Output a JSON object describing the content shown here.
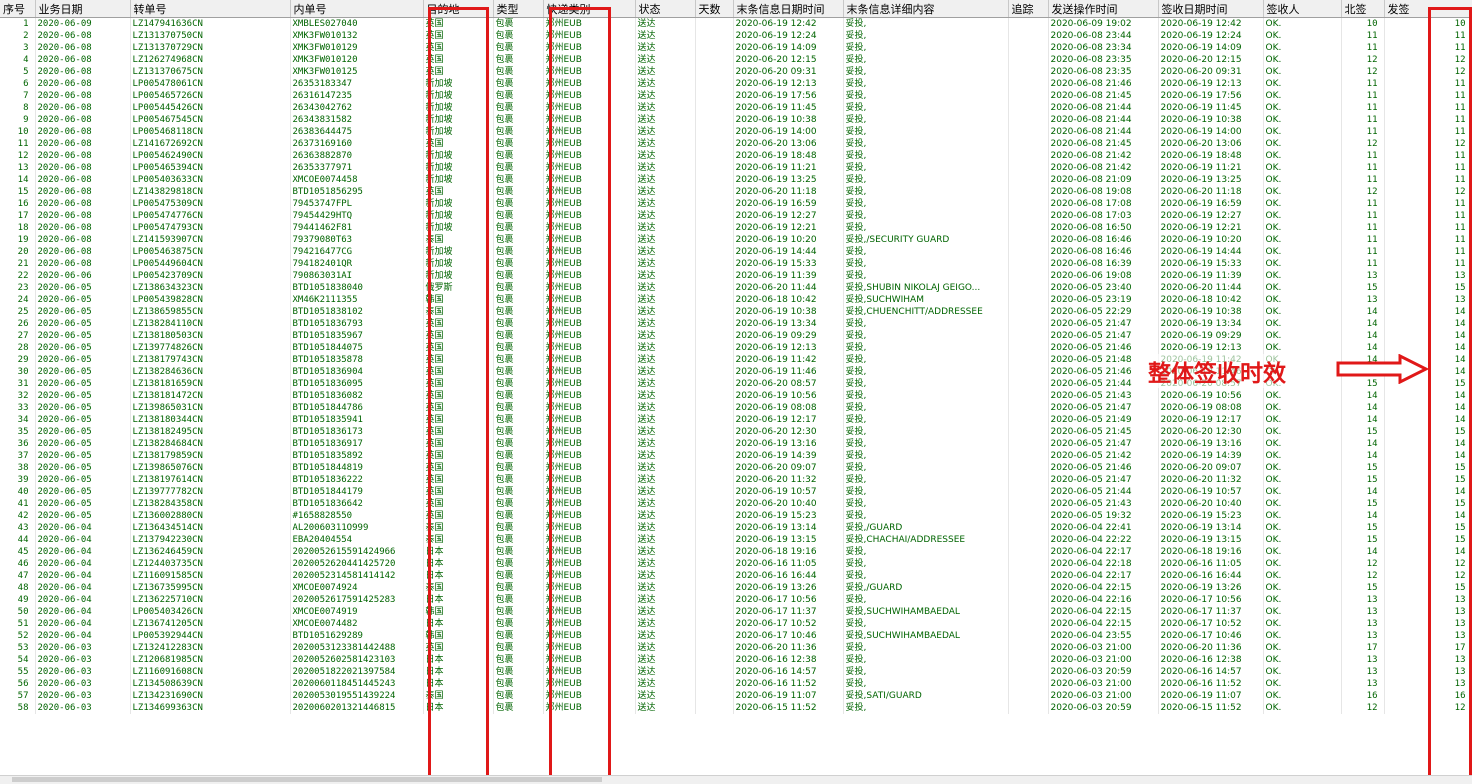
{
  "columns": [
    "序号",
    "业务日期",
    "转单号",
    "内单号",
    "目的地",
    "类型",
    "快递类别",
    "状态",
    "天数",
    "末条信息日期时间",
    "末条信息详细内容",
    "追踪",
    "发送操作时间",
    "签收日期时间",
    "签收人",
    "北签",
    "发签"
  ],
  "annotation": "整体签收时效",
  "rows": [
    [
      "1",
      "2020-06-09",
      "LZ147941636CN",
      "XMBLES027040",
      "英国",
      "包裹",
      "郑州EUB",
      "送达",
      "",
      "2020-06-19 12:42",
      "妥投,",
      "",
      "2020-06-09 19:02",
      "2020-06-19 12:42",
      "OK.",
      "10",
      "10"
    ],
    [
      "2",
      "2020-06-08",
      "LZ131370750CN",
      "XMK3FW010132",
      "英国",
      "包裹",
      "郑州EUB",
      "送达",
      "",
      "2020-06-19 12:24",
      "妥投,",
      "",
      "2020-06-08 23:44",
      "2020-06-19 12:24",
      "OK.",
      "11",
      "11"
    ],
    [
      "3",
      "2020-06-08",
      "LZ131370729CN",
      "XMK3FW010129",
      "英国",
      "包裹",
      "郑州EUB",
      "送达",
      "",
      "2020-06-19 14:09",
      "妥投,",
      "",
      "2020-06-08 23:34",
      "2020-06-19 14:09",
      "OK.",
      "11",
      "11"
    ],
    [
      "4",
      "2020-06-08",
      "LZ126274968CN",
      "XMK3FW010120",
      "英国",
      "包裹",
      "郑州EUB",
      "送达",
      "",
      "2020-06-20 12:15",
      "妥投,",
      "",
      "2020-06-08 23:35",
      "2020-06-20 12:15",
      "OK.",
      "12",
      "12"
    ],
    [
      "5",
      "2020-06-08",
      "LZ131370675CN",
      "XMK3FW010125",
      "英国",
      "包裹",
      "郑州EUB",
      "送达",
      "",
      "2020-06-20 09:31",
      "妥投,",
      "",
      "2020-06-08 23:35",
      "2020-06-20 09:31",
      "OK.",
      "12",
      "12"
    ],
    [
      "6",
      "2020-06-08",
      "LP005478061CN",
      "26353183347",
      "新加坡",
      "包裹",
      "郑州EUB",
      "送达",
      "",
      "2020-06-19 12:13",
      "妥投,",
      "",
      "2020-06-08 21:46",
      "2020-06-19 12:13",
      "OK.",
      "11",
      "11"
    ],
    [
      "7",
      "2020-06-08",
      "LP005465726CN",
      "26316147235",
      "新加坡",
      "包裹",
      "郑州EUB",
      "送达",
      "",
      "2020-06-19 17:56",
      "妥投,",
      "",
      "2020-06-08 21:45",
      "2020-06-19 17:56",
      "OK.",
      "11",
      "11"
    ],
    [
      "8",
      "2020-06-08",
      "LP005445426CN",
      "26343042762",
      "新加坡",
      "包裹",
      "郑州EUB",
      "送达",
      "",
      "2020-06-19 11:45",
      "妥投,",
      "",
      "2020-06-08 21:44",
      "2020-06-19 11:45",
      "OK.",
      "11",
      "11"
    ],
    [
      "9",
      "2020-06-08",
      "LP005467545CN",
      "26343831582",
      "新加坡",
      "包裹",
      "郑州EUB",
      "送达",
      "",
      "2020-06-19 10:38",
      "妥投,",
      "",
      "2020-06-08 21:44",
      "2020-06-19 10:38",
      "OK.",
      "11",
      "11"
    ],
    [
      "10",
      "2020-06-08",
      "LP005468118CN",
      "26383644475",
      "新加坡",
      "包裹",
      "郑州EUB",
      "送达",
      "",
      "2020-06-19 14:00",
      "妥投,",
      "",
      "2020-06-08 21:44",
      "2020-06-19 14:00",
      "OK.",
      "11",
      "11"
    ],
    [
      "11",
      "2020-06-08",
      "LZ141672692CN",
      "26373169160",
      "英国",
      "包裹",
      "郑州EUB",
      "送达",
      "",
      "2020-06-20 13:06",
      "妥投,",
      "",
      "2020-06-08 21:45",
      "2020-06-20 13:06",
      "OK.",
      "12",
      "12"
    ],
    [
      "12",
      "2020-06-08",
      "LP005462490CN",
      "26363882870",
      "新加坡",
      "包裹",
      "郑州EUB",
      "送达",
      "",
      "2020-06-19 18:48",
      "妥投,",
      "",
      "2020-06-08 21:42",
      "2020-06-19 18:48",
      "OK.",
      "11",
      "11"
    ],
    [
      "13",
      "2020-06-08",
      "LP005465394CN",
      "26353377971",
      "新加坡",
      "包裹",
      "郑州EUB",
      "送达",
      "",
      "2020-06-19 11:21",
      "妥投,",
      "",
      "2020-06-08 21:42",
      "2020-06-19 11:21",
      "OK.",
      "11",
      "11"
    ],
    [
      "14",
      "2020-06-08",
      "LP005403633CN",
      "XMCOE0074458",
      "新加坡",
      "包裹",
      "郑州EUB",
      "送达",
      "",
      "2020-06-19 13:25",
      "妥投,",
      "",
      "2020-06-08 21:09",
      "2020-06-19 13:25",
      "OK.",
      "11",
      "11"
    ],
    [
      "15",
      "2020-06-08",
      "LZ143829818CN",
      "BTD1051856295",
      "英国",
      "包裹",
      "郑州EUB",
      "送达",
      "",
      "2020-06-20 11:18",
      "妥投,",
      "",
      "2020-06-08 19:08",
      "2020-06-20 11:18",
      "OK.",
      "12",
      "12"
    ],
    [
      "16",
      "2020-06-08",
      "LP005475309CN",
      "79453747FPL",
      "新加坡",
      "包裹",
      "郑州EUB",
      "送达",
      "",
      "2020-06-19 16:59",
      "妥投,",
      "",
      "2020-06-08 17:08",
      "2020-06-19 16:59",
      "OK.",
      "11",
      "11"
    ],
    [
      "17",
      "2020-06-08",
      "LP005474776CN",
      "79454429HTQ",
      "新加坡",
      "包裹",
      "郑州EUB",
      "送达",
      "",
      "2020-06-19 12:27",
      "妥投,",
      "",
      "2020-06-08 17:03",
      "2020-06-19 12:27",
      "OK.",
      "11",
      "11"
    ],
    [
      "18",
      "2020-06-08",
      "LP005474793CN",
      "79441462F81",
      "新加坡",
      "包裹",
      "郑州EUB",
      "送达",
      "",
      "2020-06-19 12:21",
      "妥投,",
      "",
      "2020-06-08 16:50",
      "2020-06-19 12:21",
      "OK.",
      "11",
      "11"
    ],
    [
      "19",
      "2020-06-08",
      "LZ141593907CN",
      "79379080T63",
      "泰国",
      "包裹",
      "郑州EUB",
      "送达",
      "",
      "2020-06-19 10:20",
      "妥投,/SECURITY GUARD",
      "",
      "2020-06-08 16:46",
      "2020-06-19 10:20",
      "OK.",
      "11",
      "11"
    ],
    [
      "20",
      "2020-06-08",
      "LP005463875CN",
      "794216477CG",
      "新加坡",
      "包裹",
      "郑州EUB",
      "送达",
      "",
      "2020-06-19 14:44",
      "妥投,",
      "",
      "2020-06-08 16:46",
      "2020-06-19 14:44",
      "OK.",
      "11",
      "11"
    ],
    [
      "21",
      "2020-06-08",
      "LP005449604CN",
      "794182401QR",
      "新加坡",
      "包裹",
      "郑州EUB",
      "送达",
      "",
      "2020-06-19 15:33",
      "妥投,",
      "",
      "2020-06-08 16:39",
      "2020-06-19 15:33",
      "OK.",
      "11",
      "11"
    ],
    [
      "22",
      "2020-06-06",
      "LP005423709CN",
      "790863031AI",
      "新加坡",
      "包裹",
      "郑州EUB",
      "送达",
      "",
      "2020-06-19 11:39",
      "妥投,",
      "",
      "2020-06-06 19:08",
      "2020-06-19 11:39",
      "OK.",
      "13",
      "13"
    ],
    [
      "23",
      "2020-06-05",
      "LZ138634323CN",
      "BTD1051838040",
      "俄罗斯",
      "包裹",
      "郑州EUB",
      "送达",
      "",
      "2020-06-20 11:44",
      "妥投,SHUBIN NIKOLAJ GEIGO...",
      "",
      "2020-06-05 23:40",
      "2020-06-20 11:44",
      "OK.",
      "15",
      "15"
    ],
    [
      "24",
      "2020-06-05",
      "LP005439828CN",
      "XM46K2111355",
      "韩国",
      "包裹",
      "郑州EUB",
      "送达",
      "",
      "2020-06-18 10:42",
      "妥投,SUCHWIHAM",
      "",
      "2020-06-05 23:19",
      "2020-06-18 10:42",
      "OK.",
      "13",
      "13"
    ],
    [
      "25",
      "2020-06-05",
      "LZ138659855CN",
      "BTD1051838102",
      "泰国",
      "包裹",
      "郑州EUB",
      "送达",
      "",
      "2020-06-19 10:38",
      "妥投,CHUENCHITT/ADDRESSEE",
      "",
      "2020-06-05 22:29",
      "2020-06-19 10:38",
      "OK.",
      "14",
      "14"
    ],
    [
      "26",
      "2020-06-05",
      "LZ138284110CN",
      "BTD1051836793",
      "英国",
      "包裹",
      "郑州EUB",
      "送达",
      "",
      "2020-06-19 13:34",
      "妥投,",
      "",
      "2020-06-05 21:47",
      "2020-06-19 13:34",
      "OK.",
      "14",
      "14"
    ],
    [
      "27",
      "2020-06-05",
      "LZ138180503CN",
      "BTD1051835967",
      "英国",
      "包裹",
      "郑州EUB",
      "送达",
      "",
      "2020-06-19 09:29",
      "妥投,",
      "",
      "2020-06-05 21:47",
      "2020-06-19 09:29",
      "OK.",
      "14",
      "14"
    ],
    [
      "28",
      "2020-06-05",
      "LZ139774826CN",
      "BTD1051844075",
      "英国",
      "包裹",
      "郑州EUB",
      "送达",
      "",
      "2020-06-19 12:13",
      "妥投,",
      "",
      "2020-06-05 21:46",
      "2020-06-19 12:13",
      "OK.",
      "14",
      "14"
    ],
    [
      "29",
      "2020-06-05",
      "LZ138179743CN",
      "BTD1051835878",
      "英国",
      "包裹",
      "郑州EUB",
      "送达",
      "",
      "2020-06-19 11:42",
      "妥投,",
      "",
      "2020-06-05 21:48",
      "2020-06-19 11:42",
      "OK.",
      "14",
      "14"
    ],
    [
      "30",
      "2020-06-05",
      "LZ138284636CN",
      "BTD1051836904",
      "英国",
      "包裹",
      "郑州EUB",
      "送达",
      "",
      "2020-06-19 11:46",
      "妥投,",
      "",
      "2020-06-05 21:46",
      "2020-06-19 11:46",
      "OK.",
      "14",
      "14"
    ],
    [
      "31",
      "2020-06-05",
      "LZ138181659CN",
      "BTD1051836095",
      "英国",
      "包裹",
      "郑州EUB",
      "送达",
      "",
      "2020-06-20 08:57",
      "妥投,",
      "",
      "2020-06-05 21:44",
      "2020-06-20 08:57",
      "OK.",
      "15",
      "15"
    ],
    [
      "32",
      "2020-06-05",
      "LZ138181472CN",
      "BTD1051836082",
      "英国",
      "包裹",
      "郑州EUB",
      "送达",
      "",
      "2020-06-19 10:56",
      "妥投,",
      "",
      "2020-06-05 21:43",
      "2020-06-19 10:56",
      "OK.",
      "14",
      "14"
    ],
    [
      "33",
      "2020-06-05",
      "LZ139865031CN",
      "BTD1051844786",
      "英国",
      "包裹",
      "郑州EUB",
      "送达",
      "",
      "2020-06-19 08:08",
      "妥投,",
      "",
      "2020-06-05 21:47",
      "2020-06-19 08:08",
      "OK.",
      "14",
      "14"
    ],
    [
      "34",
      "2020-06-05",
      "LZ138180344CN",
      "BTD1051835941",
      "英国",
      "包裹",
      "郑州EUB",
      "送达",
      "",
      "2020-06-19 12:17",
      "妥投,",
      "",
      "2020-06-05 21:49",
      "2020-06-19 12:17",
      "OK.",
      "14",
      "14"
    ],
    [
      "35",
      "2020-06-05",
      "LZ138182495CN",
      "BTD1051836173",
      "英国",
      "包裹",
      "郑州EUB",
      "送达",
      "",
      "2020-06-20 12:30",
      "妥投,",
      "",
      "2020-06-05 21:45",
      "2020-06-20 12:30",
      "OK.",
      "15",
      "15"
    ],
    [
      "36",
      "2020-06-05",
      "LZ138284684CN",
      "BTD1051836917",
      "英国",
      "包裹",
      "郑州EUB",
      "送达",
      "",
      "2020-06-19 13:16",
      "妥投,",
      "",
      "2020-06-05 21:47",
      "2020-06-19 13:16",
      "OK.",
      "14",
      "14"
    ],
    [
      "37",
      "2020-06-05",
      "LZ138179859CN",
      "BTD1051835892",
      "英国",
      "包裹",
      "郑州EUB",
      "送达",
      "",
      "2020-06-19 14:39",
      "妥投,",
      "",
      "2020-06-05 21:42",
      "2020-06-19 14:39",
      "OK.",
      "14",
      "14"
    ],
    [
      "38",
      "2020-06-05",
      "LZ139865076CN",
      "BTD1051844819",
      "英国",
      "包裹",
      "郑州EUB",
      "送达",
      "",
      "2020-06-20 09:07",
      "妥投,",
      "",
      "2020-06-05 21:46",
      "2020-06-20 09:07",
      "OK.",
      "15",
      "15"
    ],
    [
      "39",
      "2020-06-05",
      "LZ138197614CN",
      "BTD1051836222",
      "英国",
      "包裹",
      "郑州EUB",
      "送达",
      "",
      "2020-06-20 11:32",
      "妥投,",
      "",
      "2020-06-05 21:47",
      "2020-06-20 11:32",
      "OK.",
      "15",
      "15"
    ],
    [
      "40",
      "2020-06-05",
      "LZ139777782CN",
      "BTD1051844179",
      "英国",
      "包裹",
      "郑州EUB",
      "送达",
      "",
      "2020-06-19 10:57",
      "妥投,",
      "",
      "2020-06-05 21:44",
      "2020-06-19 10:57",
      "OK.",
      "14",
      "14"
    ],
    [
      "41",
      "2020-06-05",
      "LZ138284358CN",
      "BTD1051836642",
      "英国",
      "包裹",
      "郑州EUB",
      "送达",
      "",
      "2020-06-20 10:40",
      "妥投,",
      "",
      "2020-06-05 21:43",
      "2020-06-20 10:40",
      "OK.",
      "15",
      "15"
    ],
    [
      "42",
      "2020-06-05",
      "LZ136002880CN",
      "#1658828550",
      "英国",
      "包裹",
      "郑州EUB",
      "送达",
      "",
      "2020-06-19 15:23",
      "妥投,",
      "",
      "2020-06-05 19:32",
      "2020-06-19 15:23",
      "OK.",
      "14",
      "14"
    ],
    [
      "43",
      "2020-06-04",
      "LZ136434514CN",
      "AL20060311O999",
      "泰国",
      "包裹",
      "郑州EUB",
      "送达",
      "",
      "2020-06-19 13:14",
      "妥投,/GUARD",
      "",
      "2020-06-04 22:41",
      "2020-06-19 13:14",
      "OK.",
      "15",
      "15"
    ],
    [
      "44",
      "2020-06-04",
      "LZ137942230CN",
      "EBA20404554",
      "泰国",
      "包裹",
      "郑州EUB",
      "送达",
      "",
      "2020-06-19 13:15",
      "妥投,CHACHAI/ADDRESSEE",
      "",
      "2020-06-04 22:22",
      "2020-06-19 13:15",
      "OK.",
      "15",
      "15"
    ],
    [
      "45",
      "2020-06-04",
      "LZ136246459CN",
      "2020052615591424966",
      "日本",
      "包裹",
      "郑州EUB",
      "送达",
      "",
      "2020-06-18 19:16",
      "妥投,",
      "",
      "2020-06-04 22:17",
      "2020-06-18 19:16",
      "OK.",
      "14",
      "14"
    ],
    [
      "46",
      "2020-06-04",
      "LZ124403735CN",
      "2020052620441425720",
      "日本",
      "包裹",
      "郑州EUB",
      "送达",
      "",
      "2020-06-16 11:05",
      "妥投,",
      "",
      "2020-06-04 22:18",
      "2020-06-16 11:05",
      "OK.",
      "12",
      "12"
    ],
    [
      "47",
      "2020-06-04",
      "LZ116091585CN",
      "2020052314581414142",
      "日本",
      "包裹",
      "郑州EUB",
      "送达",
      "",
      "2020-06-16 16:44",
      "妥投,",
      "",
      "2020-06-04 22:17",
      "2020-06-16 16:44",
      "OK.",
      "12",
      "12"
    ],
    [
      "48",
      "2020-06-04",
      "LZ136735995CN",
      "XMCOE0074924",
      "泰国",
      "包裹",
      "郑州EUB",
      "送达",
      "",
      "2020-06-19 13:26",
      "妥投,/GUARD",
      "",
      "2020-06-04 22:15",
      "2020-06-19 13:26",
      "OK.",
      "15",
      "15"
    ],
    [
      "49",
      "2020-06-04",
      "LZ136225710CN",
      "2020052617591425283",
      "日本",
      "包裹",
      "郑州EUB",
      "送达",
      "",
      "2020-06-17 10:56",
      "妥投,",
      "",
      "2020-06-04 22:16",
      "2020-06-17 10:56",
      "OK.",
      "13",
      "13"
    ],
    [
      "50",
      "2020-06-04",
      "LP005403426CN",
      "XMCOE0074919",
      "韩国",
      "包裹",
      "郑州EUB",
      "送达",
      "",
      "2020-06-17 11:37",
      "妥投,SUCHWIHAMBAEDAL",
      "",
      "2020-06-04 22:15",
      "2020-06-17 11:37",
      "OK.",
      "13",
      "13"
    ],
    [
      "51",
      "2020-06-04",
      "LZ136741205CN",
      "XMCOE0074482",
      "日本",
      "包裹",
      "郑州EUB",
      "送达",
      "",
      "2020-06-17 10:52",
      "妥投,",
      "",
      "2020-06-04 22:15",
      "2020-06-17 10:52",
      "OK.",
      "13",
      "13"
    ],
    [
      "52",
      "2020-06-04",
      "LP005392944CN",
      "BTD1051629289",
      "韩国",
      "包裹",
      "郑州EUB",
      "送达",
      "",
      "2020-06-17 10:46",
      "妥投,SUCHWIHAMBAEDAL",
      "",
      "2020-06-04 23:55",
      "2020-06-17 10:46",
      "OK.",
      "13",
      "13"
    ],
    [
      "53",
      "2020-06-03",
      "LZ132412283CN",
      "2020053123381442488",
      "英国",
      "包裹",
      "郑州EUB",
      "送达",
      "",
      "2020-06-20 11:36",
      "妥投,",
      "",
      "2020-06-03 21:00",
      "2020-06-20 11:36",
      "OK.",
      "17",
      "17"
    ],
    [
      "54",
      "2020-06-03",
      "LZ120681985CN",
      "2020052602581423103",
      "日本",
      "包裹",
      "郑州EUB",
      "送达",
      "",
      "2020-06-16 12:38",
      "妥投,",
      "",
      "2020-06-03 21:00",
      "2020-06-16 12:38",
      "OK.",
      "13",
      "13"
    ],
    [
      "55",
      "2020-06-03",
      "LZ116091608CN",
      "2020051822021397584",
      "日本",
      "包裹",
      "郑州EUB",
      "送达",
      "",
      "2020-06-16 14:57",
      "妥投,",
      "",
      "2020-06-03 20:59",
      "2020-06-16 14:57",
      "OK.",
      "13",
      "13"
    ],
    [
      "56",
      "2020-06-03",
      "LZ134508639CN",
      "2020060118451445243",
      "日本",
      "包裹",
      "郑州EUB",
      "送达",
      "",
      "2020-06-16 11:52",
      "妥投,",
      "",
      "2020-06-03 21:00",
      "2020-06-16 11:52",
      "OK.",
      "13",
      "13"
    ],
    [
      "57",
      "2020-06-03",
      "LZ134231690CN",
      "2020053019551439224",
      "泰国",
      "包裹",
      "郑州EUB",
      "送达",
      "",
      "2020-06-19 11:07",
      "妥投,SATI/GUARD",
      "",
      "2020-06-03 21:00",
      "2020-06-19 11:07",
      "OK.",
      "16",
      "16"
    ],
    [
      "58",
      "2020-06-03",
      "LZ134699363CN",
      "2020060201321446815",
      "日本",
      "包裹",
      "郑州EUB",
      "送达",
      "",
      "2020-06-15 11:52",
      "妥投,",
      "",
      "2020-06-03 20:59",
      "2020-06-15 11:52",
      "OK.",
      "12",
      "12"
    ]
  ]
}
